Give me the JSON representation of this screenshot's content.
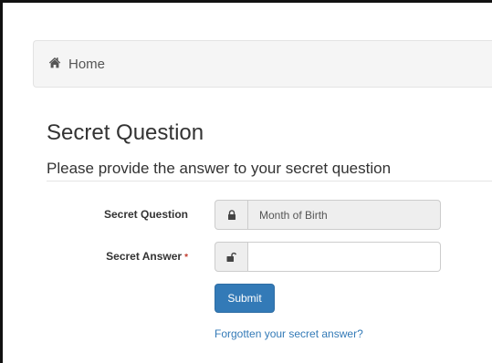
{
  "breadcrumb": {
    "home_label": "Home"
  },
  "page": {
    "title": "Secret Question",
    "subtitle": "Please provide the answer to your secret question"
  },
  "form": {
    "question_label": "Secret Question",
    "question_value": "Month of Birth",
    "answer_label": "Secret Answer",
    "answer_required_mark": "*",
    "answer_value": "",
    "submit_label": "Submit",
    "forgot_link": "Forgotten your secret answer?"
  },
  "colors": {
    "primary": "#337ab7",
    "required": "#c0392b"
  }
}
